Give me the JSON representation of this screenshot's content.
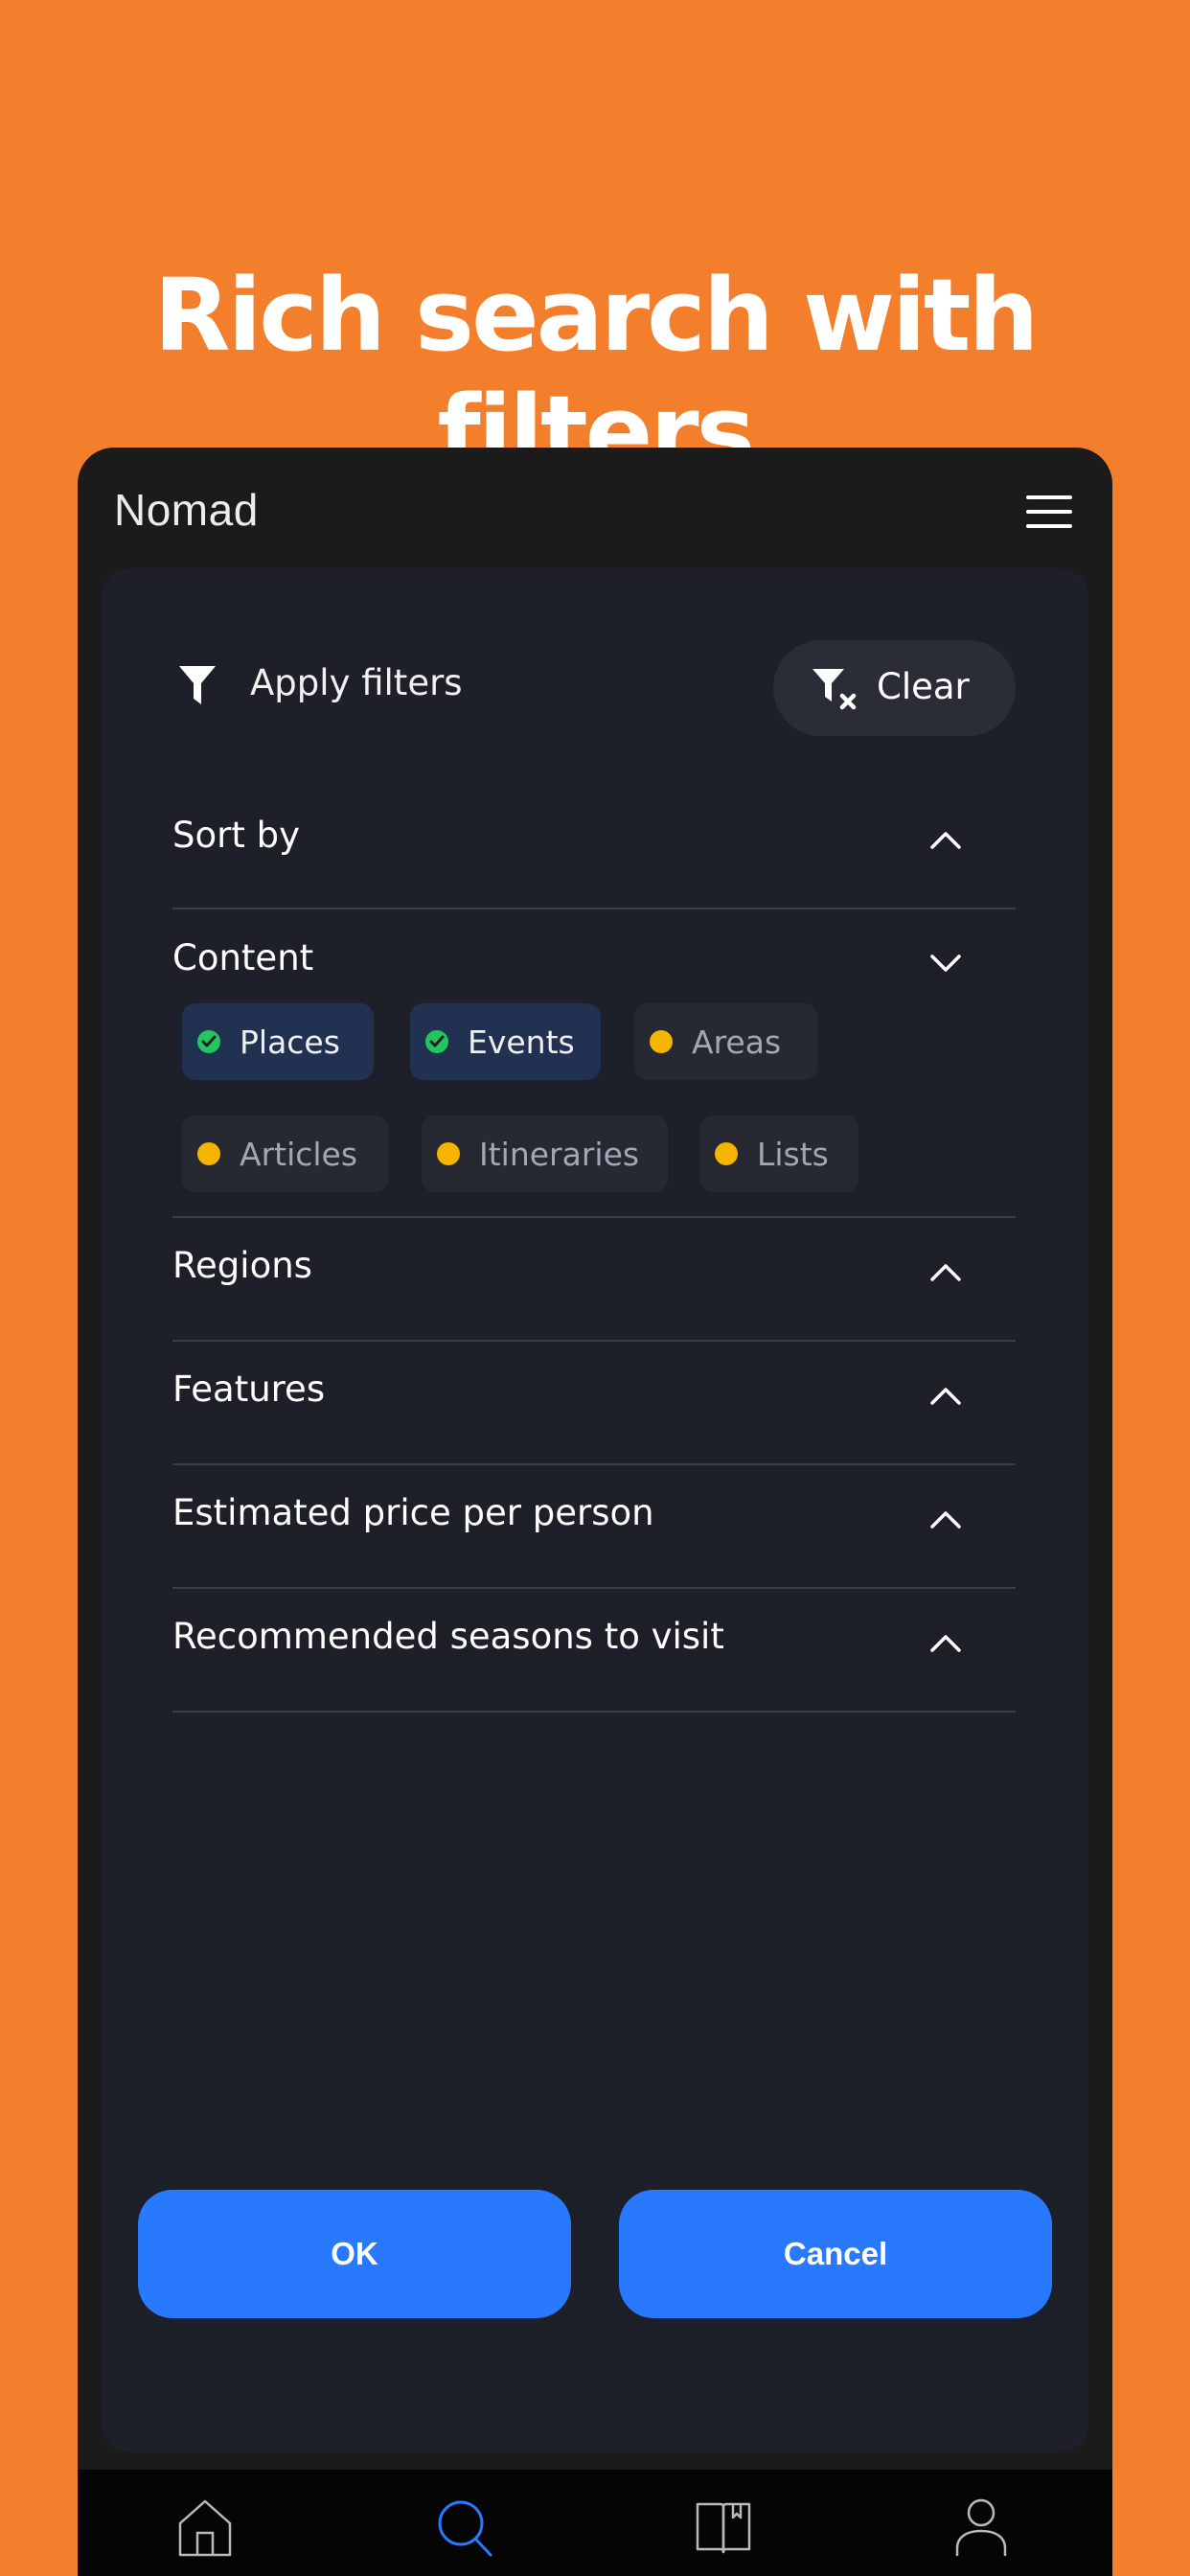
{
  "headline": "Rich search with filters",
  "app": {
    "title": "Nomad"
  },
  "icons": {
    "menu": "hamburger-menu-icon",
    "filter": "funnel-icon",
    "clear": "funnel-clear-icon",
    "expand": "chevron-up-icon",
    "collapse": "chevron-down-icon"
  },
  "filters": {
    "apply_label": "Apply filters",
    "clear_label": "Clear"
  },
  "sections": [
    {
      "title": "Sort by",
      "expanded": false
    },
    {
      "title": "Content",
      "expanded": true
    },
    {
      "title": "Regions",
      "expanded": false
    },
    {
      "title": "Features",
      "expanded": false
    },
    {
      "title": "Estimated price per person",
      "expanded": false
    },
    {
      "title": "Recommended seasons to visit",
      "expanded": false
    }
  ],
  "content_chips": [
    {
      "label": "Places",
      "selected": true
    },
    {
      "label": "Events",
      "selected": true
    },
    {
      "label": "Areas",
      "selected": false
    },
    {
      "label": "Articles",
      "selected": false
    },
    {
      "label": "Itineraries",
      "selected": false
    },
    {
      "label": "Lists",
      "selected": false
    }
  ],
  "actions": {
    "ok_label": "OK",
    "cancel_label": "Cancel"
  },
  "nav": [
    {
      "name": "home",
      "icon": "home-icon",
      "active": false
    },
    {
      "name": "search",
      "icon": "search-icon",
      "active": true
    },
    {
      "name": "guides",
      "icon": "book-icon",
      "active": false
    },
    {
      "name": "profile",
      "icon": "user-icon",
      "active": false
    }
  ],
  "colors": {
    "background": "#F37F2D",
    "accent": "#2979FF",
    "selected_dot": "#22C55E",
    "unselected_dot": "#F4B400"
  }
}
